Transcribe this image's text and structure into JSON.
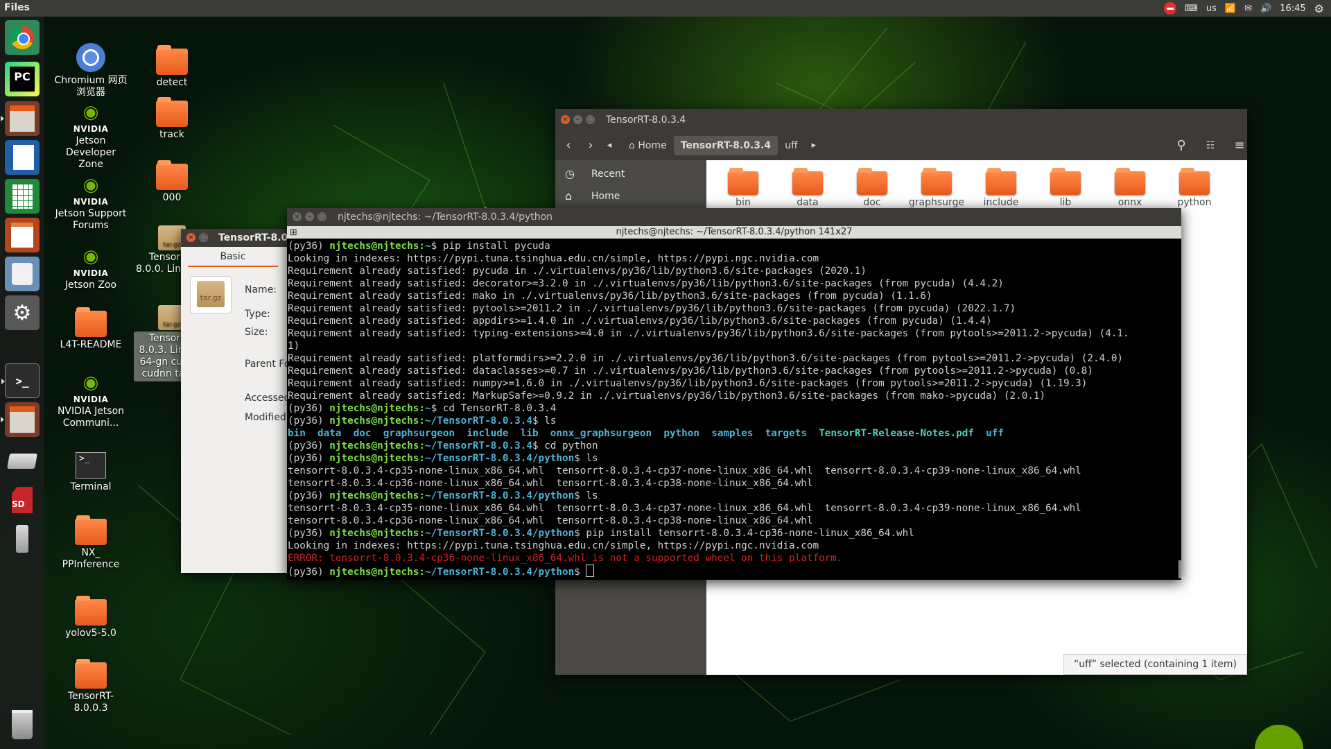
{
  "topbar": {
    "app_name": "Files",
    "keyboard": "us",
    "time": "16:45",
    "icons": [
      "no-entry-icon",
      "keyboard-icon",
      "wifi-icon",
      "mail-icon",
      "volume-icon",
      "gear-icon"
    ]
  },
  "launcher": {
    "items": [
      "chromium",
      "pycharm",
      "files",
      "writer",
      "calc",
      "impress",
      "software-center",
      "settings",
      "terminal",
      "files-2",
      "drive",
      "sd-card",
      "usb",
      "trash"
    ],
    "pycharm_label": "PC",
    "sd_label": "SD"
  },
  "desktop": {
    "icons": [
      {
        "label": "Chromium 网页浏览器"
      },
      {
        "label": "detect"
      },
      {
        "label": "track"
      },
      {
        "label": "000"
      },
      {
        "label": "Jetson Developer Zone"
      },
      {
        "label": "Jetson Support Forums"
      },
      {
        "label": "Jetson Zoo"
      },
      {
        "label": "L4T-README"
      },
      {
        "label": "NVIDIA Jetson Communi..."
      },
      {
        "label": "Terminal"
      },
      {
        "label": "NX_ PPInference"
      },
      {
        "label": "yolov5-5.0"
      },
      {
        "label": "TensorRT-8.0.0.3"
      },
      {
        "label": "TensorRT- 8.0.0. Linux.x8"
      },
      {
        "label": "TensorRT- 8.0.3. Linux.x 64-gn cuda-1 cudnn tar.gz"
      }
    ],
    "nvidia_word": "NVIDIA",
    "targz_label": "tar.gz"
  },
  "files_window": {
    "title": "TensorRT-8.0.3.4",
    "crumbs": [
      "Home",
      "TensorRT-8.0.3.4",
      "uff"
    ],
    "sidebar": [
      "Recent",
      "Home"
    ],
    "folders": [
      "bin",
      "data",
      "doc",
      "graphsurge",
      "include",
      "lib",
      "onnx",
      "python"
    ],
    "status": "“uff” selected  (containing 1 item)"
  },
  "properties": {
    "title": "TensorRT-8.0.",
    "tab": "Basic",
    "fields": [
      "Name:",
      "Type:",
      "Size:",
      "Parent Fo",
      "Accessed",
      "Modified"
    ],
    "icon_label": "tar.gz"
  },
  "terminal": {
    "title": "njtechs@njtechs: ~/TensorRT-8.0.3.4/python",
    "subtitle": "njtechs@njtechs: ~/TensorRT-8.0.3.4/python 141x27",
    "prompt_env": "(py36) ",
    "user_host": "njtechs@njtechs",
    "lines": [
      {
        "kind": "prompt",
        "path": "~",
        "cmd": "pip install pycuda"
      },
      {
        "kind": "text",
        "text": "Looking in indexes: https://pypi.tuna.tsinghua.edu.cn/simple, https://pypi.ngc.nvidia.com"
      },
      {
        "kind": "text",
        "text": "Requirement already satisfied: pycuda in ./.virtualenvs/py36/lib/python3.6/site-packages (2020.1)"
      },
      {
        "kind": "text",
        "text": "Requirement already satisfied: decorator>=3.2.0 in ./.virtualenvs/py36/lib/python3.6/site-packages (from pycuda) (4.4.2)"
      },
      {
        "kind": "text",
        "text": "Requirement already satisfied: mako in ./.virtualenvs/py36/lib/python3.6/site-packages (from pycuda) (1.1.6)"
      },
      {
        "kind": "text",
        "text": "Requirement already satisfied: pytools>=2011.2 in ./.virtualenvs/py36/lib/python3.6/site-packages (from pycuda) (2022.1.7)"
      },
      {
        "kind": "text",
        "text": "Requirement already satisfied: appdirs>=1.4.0 in ./.virtualenvs/py36/lib/python3.6/site-packages (from pycuda) (1.4.4)"
      },
      {
        "kind": "text",
        "text": "Requirement already satisfied: typing-extensions>=4.0 in ./.virtualenvs/py36/lib/python3.6/site-packages (from pytools>=2011.2->pycuda) (4.1."
      },
      {
        "kind": "text",
        "text": "1)"
      },
      {
        "kind": "text",
        "text": "Requirement already satisfied: platformdirs>=2.2.0 in ./.virtualenvs/py36/lib/python3.6/site-packages (from pytools>=2011.2->pycuda) (2.4.0)"
      },
      {
        "kind": "text",
        "text": "Requirement already satisfied: dataclasses>=0.7 in ./.virtualenvs/py36/lib/python3.6/site-packages (from pytools>=2011.2->pycuda) (0.8)"
      },
      {
        "kind": "text",
        "text": "Requirement already satisfied: numpy>=1.6.0 in ./.virtualenvs/py36/lib/python3.6/site-packages (from pytools>=2011.2->pycuda) (1.19.3)"
      },
      {
        "kind": "text",
        "text": "Requirement already satisfied: MarkupSafe>=0.9.2 in ./.virtualenvs/py36/lib/python3.6/site-packages (from mako->pycuda) (2.0.1)"
      },
      {
        "kind": "prompt",
        "path": "~",
        "cmd": "cd TensorRT-8.0.3.4"
      },
      {
        "kind": "prompt",
        "path": "~/TensorRT-8.0.3.4",
        "cmd": "ls"
      },
      {
        "kind": "ls",
        "dirs": [
          "bin",
          "data",
          "doc",
          "graphsurgeon",
          "include",
          "lib",
          "onnx_graphsurgeon",
          "python",
          "samples",
          "targets"
        ],
        "file": "TensorRT-Release-Notes.pdf",
        "last": "uff"
      },
      {
        "kind": "prompt",
        "path": "~/TensorRT-8.0.3.4",
        "cmd": "cd python"
      },
      {
        "kind": "prompt",
        "path": "~/TensorRT-8.0.3.4/python",
        "cmd": "ls"
      },
      {
        "kind": "text",
        "text": "tensorrt-8.0.3.4-cp35-none-linux_x86_64.whl  tensorrt-8.0.3.4-cp37-none-linux_x86_64.whl  tensorrt-8.0.3.4-cp39-none-linux_x86_64.whl"
      },
      {
        "kind": "text",
        "text": "tensorrt-8.0.3.4-cp36-none-linux_x86_64.whl  tensorrt-8.0.3.4-cp38-none-linux_x86_64.whl"
      },
      {
        "kind": "prompt",
        "path": "~/TensorRT-8.0.3.4/python",
        "cmd": "ls"
      },
      {
        "kind": "text",
        "text": "tensorrt-8.0.3.4-cp35-none-linux_x86_64.whl  tensorrt-8.0.3.4-cp37-none-linux_x86_64.whl  tensorrt-8.0.3.4-cp39-none-linux_x86_64.whl"
      },
      {
        "kind": "text",
        "text": "tensorrt-8.0.3.4-cp36-none-linux_x86_64.whl  tensorrt-8.0.3.4-cp38-none-linux_x86_64.whl"
      },
      {
        "kind": "prompt",
        "path": "~/TensorRT-8.0.3.4/python",
        "cmd": "pip install tensorrt-8.0.3.4-cp36-none-linux_x86_64.whl"
      },
      {
        "kind": "text",
        "text": "Looking in indexes: https://pypi.tuna.tsinghua.edu.cn/simple, https://pypi.ngc.nvidia.com"
      },
      {
        "kind": "error",
        "text": "ERROR: tensorrt-8.0.3.4-cp36-none-linux_x86_64.whl is not a supported wheel on this platform."
      },
      {
        "kind": "prompt",
        "path": "~/TensorRT-8.0.3.4/python",
        "cmd": "",
        "cursor": true
      }
    ]
  }
}
